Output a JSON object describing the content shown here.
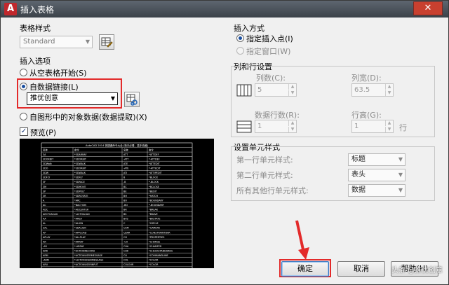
{
  "window": {
    "title": "插入表格",
    "close": "✕"
  },
  "table_style": {
    "heading": "表格样式",
    "selected": "Standard"
  },
  "insert_options": {
    "heading": "插入选项",
    "opt_empty": "从空表格开始(S)",
    "opt_datalink": "自数据链接(L)",
    "datalink_selected": "推优创意",
    "opt_drawing": "自图形中的对象数据(数据提取)(X)"
  },
  "preview": {
    "label": "预览(P)",
    "checked": true,
    "table_title": "AutoCAD 2014 快捷键命令大全 (新手必看、高手收藏)",
    "columns": [
      "名称",
      "命令",
      "名称",
      "命令"
    ],
    "rows": [
      [
        "3A",
        "*3DARRAY",
        "ATT",
        "*ATTDEF"
      ],
      [
        "3DORBIT",
        "*3DORBIT",
        "-ATT",
        "*-ATTDEF"
      ],
      [
        "3DWalk",
        "*3DWALK",
        "ATE",
        "*ATTEDIT"
      ],
      [
        "3DO",
        "*3DORBIT",
        "-ATE",
        "*-ATTEDIT"
      ],
      [
        "3DW",
        "*3DWALK",
        "ATI",
        "*ATTIPEDIT"
      ],
      [
        "3DFLY",
        "*3DFLY",
        "B",
        "*BLOCK"
      ],
      [
        "3F",
        "*3DFACE",
        "-B",
        "*-BLOCK"
      ],
      [
        "3M",
        "*3DMOVE",
        "BC",
        "*BCLOSE"
      ],
      [
        "3P",
        "*3DPOLY",
        "BE",
        "*BEDIT"
      ],
      [
        "3R",
        "*3DROTATE",
        "BH",
        "*HATCH"
      ],
      [
        "A",
        "*ARC",
        "BO",
        "*BOUNDARY"
      ],
      [
        "AC",
        "*BACTION",
        "-BO",
        "*-BOUNDARY"
      ],
      [
        "ADC",
        "*ADCENTER",
        "BR",
        "*BREAK"
      ],
      [
        "AECTOACAD",
        "*-ACTOACAD",
        "BS",
        "*BSAVE"
      ],
      [
        "AA",
        "*AREA",
        "BVS",
        "*BVSTATE"
      ],
      [
        "AL",
        "*ALIGN",
        "C",
        "*CIRCLE"
      ],
      [
        "3AL",
        "*3DALIGN",
        "CAM",
        "*CAMERA"
      ],
      [
        "AP",
        "*APPLOAD",
        "CBAR",
        "*CONSTRAINTBAR"
      ],
      [
        "APLAY",
        "*ALLPLAY",
        "CH",
        "*PROPERTIES"
      ],
      [
        "AR",
        "*ARRAY",
        "-CH",
        "*CHANGE"
      ],
      [
        "-AR",
        "*-ARRAY",
        "CHA",
        "*CHAMFER"
      ],
      [
        "ARR",
        "*ACTIONRECORD",
        "CHK",
        "*CHECKSTANDARDS"
      ],
      [
        "ARM",
        "*ACTIONUSERMESSAGE",
        "CLI",
        "*COMMANDLINE"
      ],
      [
        "-ARM",
        "*-ACTIONUSERMESSAGE",
        "COL",
        "*COLOR"
      ],
      [
        "ARU",
        "*ACTIONUSERINPUT",
        "COLOUR",
        "*COLOR"
      ],
      [
        "ARS",
        "*ACTIONSTOP",
        "CO",
        "*COPY"
      ]
    ]
  },
  "insert_method": {
    "heading": "插入方式",
    "opt_point": "指定插入点(I)",
    "opt_window": "指定窗口(W)"
  },
  "rows_cols": {
    "heading": "列和行设置",
    "columns_label": "列数(C):",
    "columns_value": "5",
    "colwidth_label": "列宽(D):",
    "colwidth_value": "63.5",
    "datarows_label": "数据行数(R):",
    "datarows_value": "1",
    "rowheight_label": "行高(G):",
    "rowheight_value": "1",
    "rowheight_unit": "行"
  },
  "cell_styles": {
    "heading": "设置单元样式",
    "first_row_label": "第一行单元样式:",
    "first_row_value": "标题",
    "second_row_label": "第二行单元样式:",
    "second_row_value": "表头",
    "other_rows_label": "所有其他行单元样式:",
    "other_rows_value": "数据"
  },
  "buttons": {
    "ok": "确定",
    "cancel": "取消",
    "help": "帮助(H)"
  },
  "watermark": "头条 @推优创意",
  "colors": {
    "accent_red": "#e32a2a",
    "title_bar": "#4a5158"
  }
}
